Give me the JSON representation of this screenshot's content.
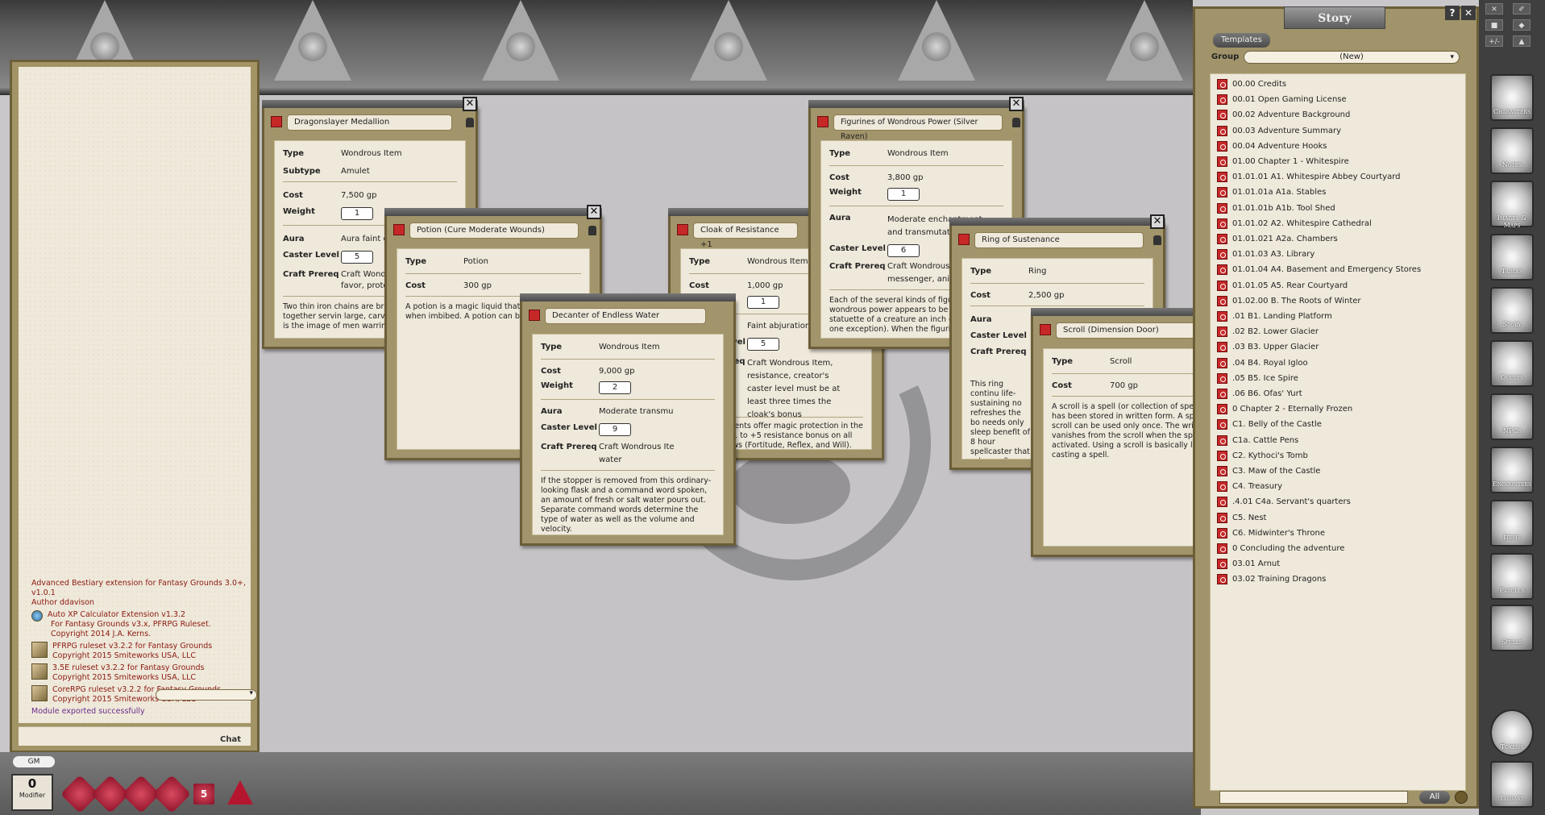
{
  "chat": {
    "messages": [
      {
        "text": "Advanced Bestiary extension for Fantasy Grounds 3.0+, v1.0.1"
      },
      {
        "text": "Author ddavison"
      }
    ],
    "extensions": [
      {
        "icon": "globe-icon",
        "lines": [
          "Auto XP Calculator Extension v1.3.2",
          "For Fantasy Grounds v3.x, PFRPG Ruleset.",
          "Copyright 2014 J.A. Kerns."
        ]
      },
      {
        "icon": "ruleset-box-icon",
        "lines": [
          "PFRPG ruleset v3.2.2 for Fantasy Grounds",
          "Copyright 2015 Smiteworks USA, LLC"
        ]
      },
      {
        "icon": "ruleset-box-icon",
        "lines": [
          "3.5E ruleset v3.2.2 for Fantasy Grounds",
          "Copyright 2015 Smiteworks USA, LLC"
        ]
      },
      {
        "icon": "ruleset-box-icon",
        "lines": [
          "CoreRPG ruleset v3.2.2 for Fantasy Grounds",
          "Copyright 2015 Smiteworks USA, LLC"
        ]
      }
    ],
    "status": "Module exported successfully",
    "chat_label": "Chat",
    "gm_label": "GM",
    "modifier_value": "0",
    "modifier_label": "Modifier"
  },
  "dice": [
    "d4",
    "d6",
    "d8",
    "d10",
    "d12",
    "d20"
  ],
  "dice_labels": {
    "d12": "5"
  },
  "story": {
    "title": "Story",
    "help_label": "?",
    "close_label": "✕",
    "templates_label": "Templates",
    "group_label": "Group",
    "group_value": "(New)",
    "all_label": "All",
    "items": [
      "00.00 Credits",
      "00.01 Open Gaming License",
      "00.02 Adventure Background",
      "00.03 Adventure Summary",
      "00.04 Adventure Hooks",
      "01.00 Chapter 1 - Whitespire",
      "01.01.01 A1. Whitespire Abbey Courtyard",
      "01.01.01a A1a. Stables",
      "01.01.01b A1b. Tool Shed",
      "01.01.02 A2. Whitespire Cathedral",
      "01.01.021 A2a. Chambers",
      "01.01.03 A3. Library",
      "01.01.04 A4. Basement and Emergency Stores",
      "01.01.05 A5. Rear Courtyard",
      "01.02.00 B. The Roots of Winter",
      ".01 B1. Landing Platform",
      ".02 B2. Lower Glacier",
      ".03 B3. Upper Glacier",
      ".04 B4. Royal Igloo",
      ".05 B5. Ice Spire",
      ".06 B6. Ofas' Yurt",
      "0 Chapter 2 - Eternally Frozen",
      " C1. Belly of the Castle",
      " C1a. Cattle Pens",
      " C2. Kythoci's Tomb",
      " C3. Maw of the Castle",
      " C4. Treasury",
      ".4.01 C4a. Servant's quarters",
      " C5. Nest",
      " C6. Midwinter's Throne",
      "0 Concluding the adventure",
      "03.01 Arnut",
      "03.02 Training Dragons"
    ]
  },
  "sidebar": {
    "tools": [
      "✕",
      "✐",
      "■",
      "◆",
      "+/-",
      "▲"
    ],
    "buttons": [
      "Characters",
      "Notes",
      "Images & Maps",
      "Tables",
      "Story",
      "Quests",
      "NPCs",
      "Encounters",
      "Items",
      "Parcels",
      "Spells",
      "Tokens",
      "Library"
    ]
  },
  "windows": {
    "medallion": {
      "name": "Dragonslayer Medallion",
      "type": "Wondrous Item",
      "subtype": "Amulet",
      "cost": "7,500 gp",
      "weight": "1",
      "aura": "Aura faint e",
      "caster_level": "5",
      "craft_prereq": "Craft Wond",
      "craft_prereq2": "favor, prote",
      "desc": "Two thin iron chains are brai one of gold, together servin large, carved dragon scale. D is the image of men warring"
    },
    "potion": {
      "name": "Potion (Cure Moderate Wounds)",
      "type": "Potion",
      "cost": "300 gp",
      "desc": "A potion is a magic liquid that pr when imbibed. A potion can be c"
    },
    "decanter": {
      "name": "Decanter of Endless Water",
      "type": "Wondrous Item",
      "cost": "9,000 gp",
      "weight": "2",
      "aura": "Moderate transmu",
      "caster_level": "9",
      "craft_prereq": "Craft Wondrous Ite",
      "craft_prereq2": "water",
      "desc": "If the stopper is removed from this ordinary-looking flask and a command word spoken, an amount of fresh or salt water pours out. Separate command words determine the type of water as well as the volume and velocity."
    },
    "cloak": {
      "name": "Cloak of Resistance +1",
      "type": "Wondrous Item",
      "cost": "1,000 gp",
      "weight": "1",
      "aura": "Faint abjuration",
      "caster_level": "5",
      "craft_prereq": "Craft Wondrous Item, resistance, creator's caster level must be at least three times the cloak's bonus",
      "desc": "These garments offer magic protection in the form of a +1 to +5 resistance bonus on all saving throws (Fortitude, Reflex, and Will)."
    },
    "figurines": {
      "name": "Figurines of Wondrous Power (Silver Raven)",
      "type": "Wondrous Item",
      "cost": "3,800 gp",
      "weight": "1",
      "aura": "Moderate enchantment and transmutation",
      "caster_level": "6",
      "craft_prereq": "Craft Wondrous I",
      "craft_prereq2": "messenger, anim",
      "desc": "Each of the several kinds of figurin wondrous power appears to be a r statuette of a creature an inch or one exception). When the figurin"
    },
    "ring": {
      "name": "Ring of Sustenance",
      "type": "Ring",
      "cost": "2,500 gp",
      "desc": "This ring continu life-sustaining no refreshes the bo needs only sleep benefit of 8 hour spellcaster that r do so after only 2"
    },
    "scroll": {
      "name": "Scroll (Dimension Door)",
      "type": "Scroll",
      "cost": "700 gp",
      "desc": "A scroll is a spell (or collection of spells) that has been stored in written form. A spell on a scroll can be used only once. The writing vanishes from the scroll when the spell is activated. Using a scroll is basically like casting a spell."
    }
  },
  "labels": {
    "type": "Type",
    "subtype": "Subtype",
    "cost": "Cost",
    "weight": "Weight",
    "aura": "Aura",
    "caster_level": "Caster Level",
    "craft_prereq": "Craft Prereq"
  },
  "colors": {
    "parchment": "#efe9db",
    "frame": "#a2956b",
    "accent_red": "#8b1a10"
  }
}
